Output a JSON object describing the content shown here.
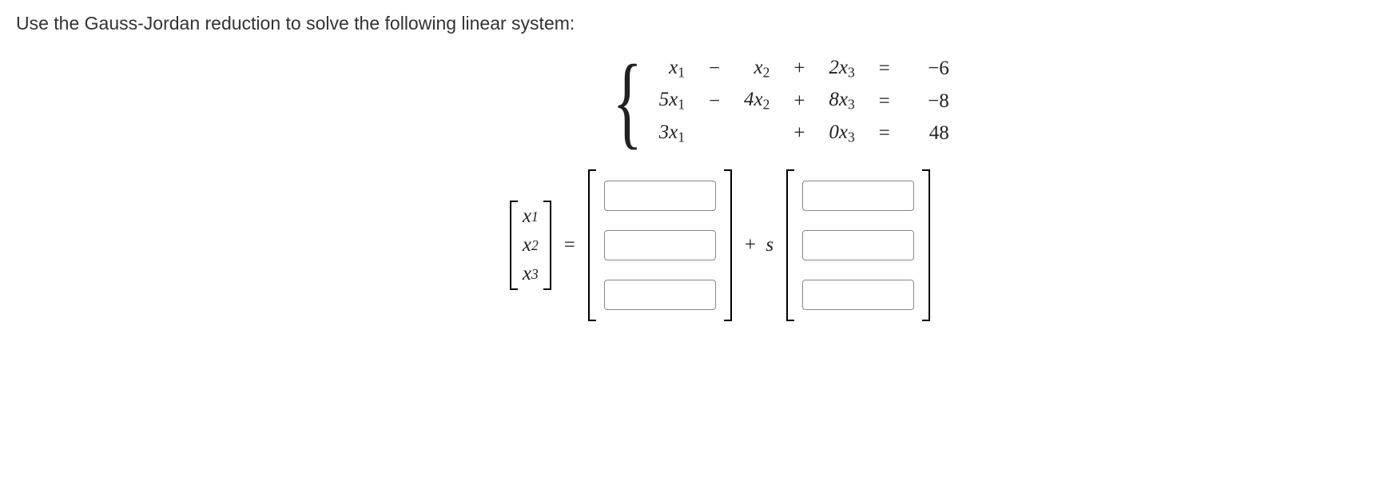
{
  "question": "Use the Gauss-Jordan reduction to solve the following linear system:",
  "system": {
    "rows": [
      {
        "t1": "x",
        "s1": "1",
        "op1": "−",
        "t2": "x",
        "s2": "2",
        "op2": "+",
        "t3": "2x",
        "s3": "3",
        "eq": "=",
        "rhs": "−6"
      },
      {
        "t1": "5x",
        "s1": "1",
        "op1": "−",
        "t2": "4x",
        "s2": "2",
        "op2": "+",
        "t3": "8x",
        "s3": "3",
        "eq": "=",
        "rhs": "−8"
      },
      {
        "t1": "3x",
        "s1": "1",
        "op1": "",
        "t2": "",
        "s2": "",
        "op2": "+",
        "t3": "0x",
        "s3": "3",
        "eq": "=",
        "rhs": "48"
      }
    ]
  },
  "answer": {
    "vars": [
      {
        "name": "x",
        "sub": "1"
      },
      {
        "name": "x",
        "sub": "2"
      },
      {
        "name": "x",
        "sub": "3"
      }
    ],
    "equals": "=",
    "plus": "+",
    "param": "s",
    "vec1": [
      "",
      "",
      ""
    ],
    "vec2": [
      "",
      "",
      ""
    ]
  }
}
